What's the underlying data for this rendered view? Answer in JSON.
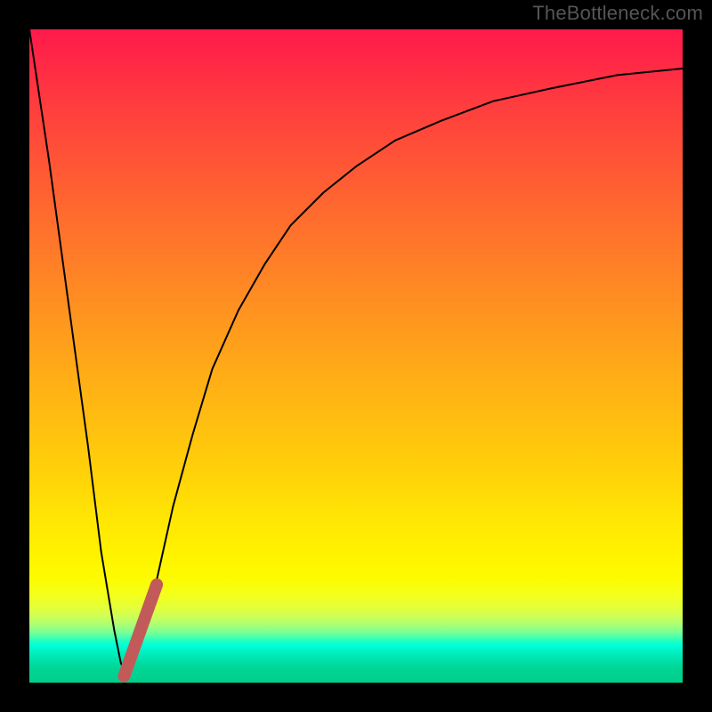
{
  "watermark": "TheBottleneck.com",
  "chart_data": {
    "type": "line",
    "title": "",
    "xlabel": "",
    "ylabel": "",
    "xlim": [
      0,
      100
    ],
    "ylim": [
      0,
      100
    ],
    "grid": false,
    "legend": false,
    "series": [
      {
        "name": "bottleneck-curve",
        "x": [
          0,
          3,
          6,
          9,
          11,
          13,
          14,
          15,
          16,
          18,
          20,
          22,
          25,
          28,
          32,
          36,
          40,
          45,
          50,
          56,
          63,
          71,
          80,
          90,
          100
        ],
        "values": [
          100,
          80,
          58,
          36,
          20,
          8,
          3,
          1,
          3,
          9,
          18,
          27,
          38,
          48,
          57,
          64,
          70,
          75,
          79,
          83,
          86,
          89,
          91,
          93,
          94
        ]
      }
    ],
    "highlight_segment": {
      "name": "user-position",
      "x_range": [
        14.5,
        19.5
      ],
      "value_range": [
        1,
        15
      ]
    },
    "background_gradient": {
      "type": "vertical-risk",
      "stops": [
        {
          "pos": 0.0,
          "color": "#ff1a4b"
        },
        {
          "pos": 0.4,
          "color": "#ff8a22"
        },
        {
          "pos": 0.75,
          "color": "#ffe604"
        },
        {
          "pos": 0.9,
          "color": "#caff5a"
        },
        {
          "pos": 0.94,
          "color": "#1affc4"
        },
        {
          "pos": 1.0,
          "color": "#00cf8c"
        }
      ]
    }
  }
}
